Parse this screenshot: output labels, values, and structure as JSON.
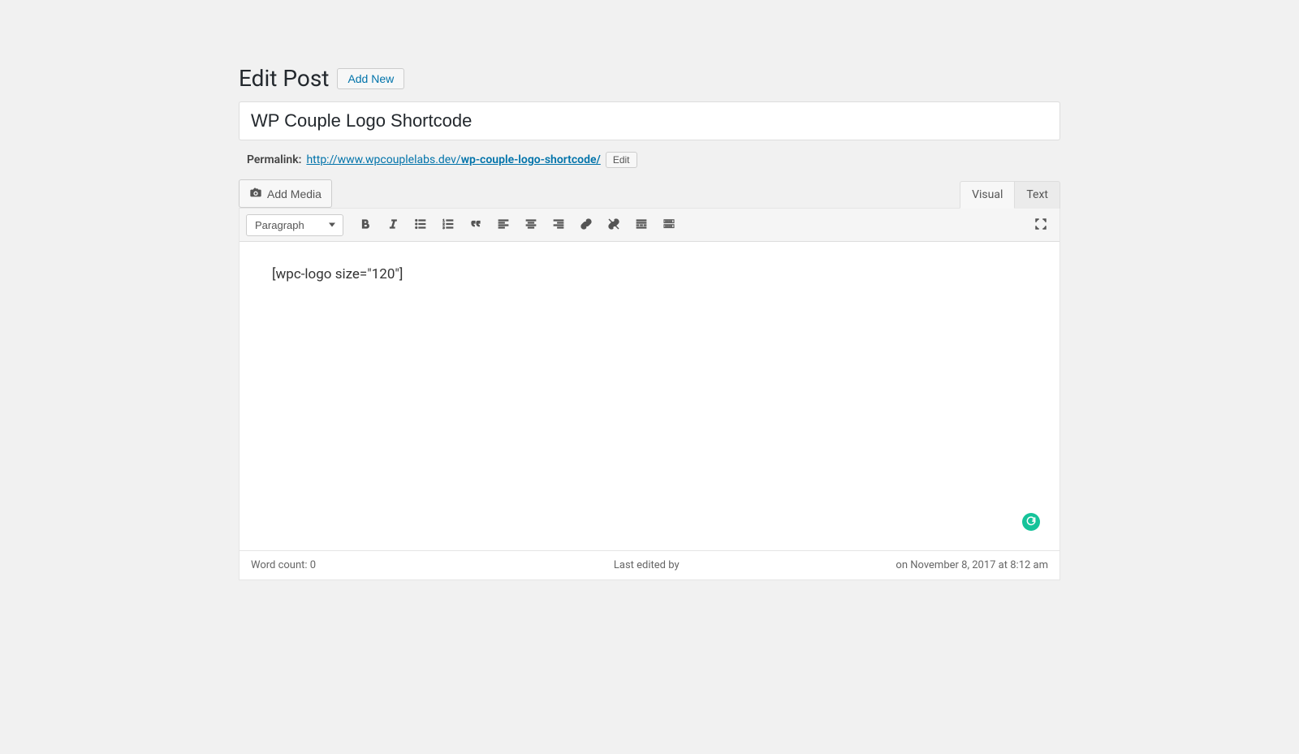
{
  "header": {
    "title": "Edit Post",
    "add_new_label": "Add New"
  },
  "post": {
    "title": "WP Couple Logo Shortcode"
  },
  "permalink": {
    "label": "Permalink:",
    "base": "http://www.wpcouplelabs.dev/",
    "slug": "wp-couple-logo-shortcode/",
    "edit_label": "Edit"
  },
  "media": {
    "add_media_label": "Add Media"
  },
  "tabs": {
    "visual": "Visual",
    "text": "Text"
  },
  "toolbar": {
    "format_value": "Paragraph"
  },
  "editor": {
    "content": "[wpc-logo size=\"120\"]"
  },
  "statusbar": {
    "word_count": "Word count: 0",
    "last_edited": "Last edited by",
    "timestamp": "on November 8, 2017 at 8:12 am"
  }
}
